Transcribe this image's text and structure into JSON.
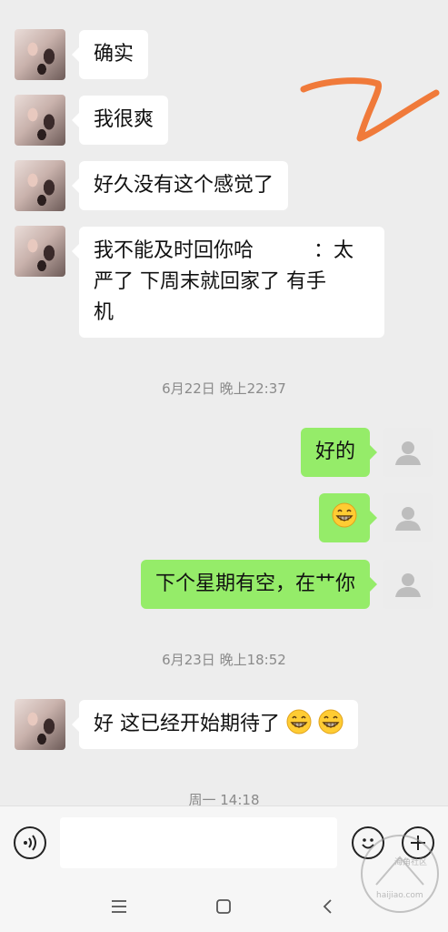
{
  "messages": [
    {
      "from": "her",
      "text": "确实"
    },
    {
      "from": "her",
      "text": "我很爽"
    },
    {
      "from": "her",
      "text": "好久没有这个感觉了"
    },
    {
      "from": "her",
      "lines": [
        "我不能及时回你哈　　　：太",
        "严了 下周末就回家了 有手",
        "机"
      ]
    },
    {
      "from": "me",
      "text": "好的"
    },
    {
      "from": "me",
      "emoji": "grinning-face-emoji"
    },
    {
      "from": "me",
      "text": "下个星期有空，在艹你"
    },
    {
      "from": "her",
      "text": "好 这已经开始期待了",
      "emoji_count": 2
    }
  ],
  "timestamps": [
    "6月22日 晚上22:37",
    "6月23日 晚上18:52",
    "周一 14:18"
  ],
  "input": {
    "value": "",
    "placeholder": ""
  },
  "icons": {
    "voice": "voice-icon",
    "sticker": "emoji-icon",
    "more": "plus-icon",
    "menu": "menu-icon",
    "home": "home-icon",
    "back": "back-icon"
  },
  "colors": {
    "background": "#ededed",
    "incoming_bubble": "#ffffff",
    "outgoing_bubble": "#95ec69",
    "scribble": "#f07a3a"
  },
  "watermark": {
    "line1": "海角社区",
    "line2": "haijiao.com"
  }
}
